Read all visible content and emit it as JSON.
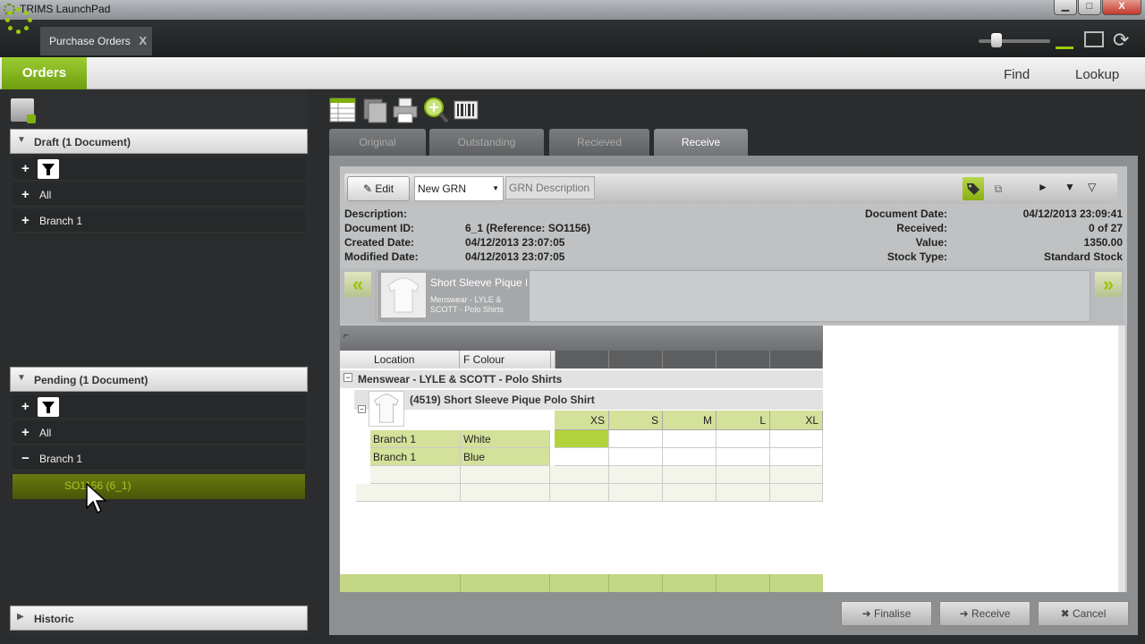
{
  "window": {
    "title": "TRIMS LaunchPad",
    "minimize": "▁",
    "maximize": "□",
    "close": "X"
  },
  "app": {
    "tab_label": "Purchase Orders",
    "tab_close": "X"
  },
  "menubar": {
    "orders": "Orders",
    "find": "Find",
    "lookup": "Lookup"
  },
  "left": {
    "draft": {
      "header": "Draft (1 Document)",
      "rows": [
        {
          "sign": "+",
          "label": "All"
        },
        {
          "sign": "+",
          "label": "Branch 1"
        }
      ]
    },
    "pending": {
      "header": "Pending (1 Document)",
      "rows": [
        {
          "sign": "+",
          "label": "All"
        },
        {
          "sign": "−",
          "label": "Branch 1"
        }
      ],
      "selected_doc": "SO1156 (6_1)"
    },
    "historic": {
      "header": "Historic"
    },
    "plus": "+"
  },
  "tabs": [
    "Original",
    "Outstanding",
    "Recieved",
    "Receive"
  ],
  "grn": {
    "edit_label": "Edit",
    "grn_select": "New GRN",
    "grn_desc_placeholder": "GRN Description"
  },
  "doc_info": {
    "left": [
      {
        "label": "Description:",
        "value": ""
      },
      {
        "label": "Document ID:",
        "value": "6_1 (Reference: SO1156)"
      },
      {
        "label": "Created Date:",
        "value": "04/12/2013 23:07:05"
      },
      {
        "label": "Modified Date:",
        "value": "04/12/2013 23:07:05"
      }
    ],
    "right": [
      {
        "label": "Document Date:",
        "value": "04/12/2013 23:09:41"
      },
      {
        "label": "Received:",
        "value": "0 of 27"
      },
      {
        "label": "Value:",
        "value": "1350.00"
      },
      {
        "label": "Stock Type:",
        "value": "Standard Stock"
      }
    ]
  },
  "product_card": {
    "title": "Short Sleeve Pique F",
    "subtitle": "Menswear - LYLE & SCOTT - Polo Shirts"
  },
  "grid": {
    "columns": [
      "Location",
      "F Colour"
    ],
    "group_label": "Menswear - LYLE & SCOTT - Polo Shirts",
    "item_title": "(4519) Short Sleeve Pique Polo Shirt",
    "sizes": [
      "XS",
      "S",
      "M",
      "L",
      "XL"
    ],
    "rows": [
      {
        "location": "Branch 1",
        "colour": "White"
      },
      {
        "location": "Branch 1",
        "colour": "Blue"
      }
    ]
  },
  "buttons": {
    "finalise": "Finalise",
    "receive": "Receive",
    "cancel": "Cancel"
  },
  "colors": {
    "accent": "#8ab010",
    "grid_header": "#d3e19a"
  }
}
